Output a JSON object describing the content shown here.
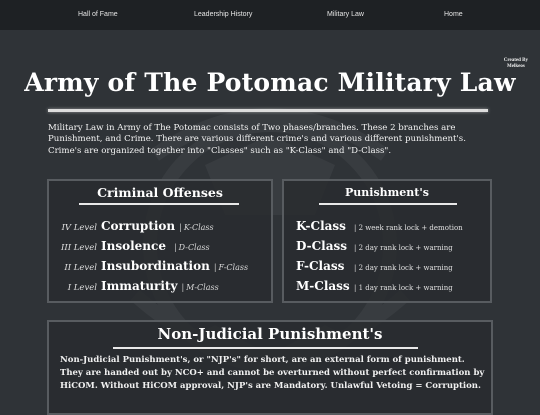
{
  "nav": {
    "items": [
      {
        "label": "Hall of Fame"
      },
      {
        "label": "Leadership History"
      },
      {
        "label": "Military Law"
      },
      {
        "label": "Home"
      }
    ]
  },
  "header": {
    "credit_line1": "Created By",
    "credit_line2": "Melkeos",
    "title": "Army of The Potomac Military Law"
  },
  "intro": {
    "text": "Military Law in Army of The Potomac consists of Two phases/branches. These 2 branches are Punishment, and Crime. There are various different crime's and various different punishment's. Crime's are organized together into \"Classes\" such as \"K-Class\" and \"D-Class\"."
  },
  "offenses": {
    "heading": "Criminal Offenses",
    "rows": [
      {
        "level": "IV Level",
        "name": "Corruption",
        "class": "K-Class"
      },
      {
        "level": "III Level",
        "name": "Insolence",
        "class": "D-Class"
      },
      {
        "level": "II Level",
        "name": "Insubordination",
        "class": "F-Class"
      },
      {
        "level": "I Level",
        "name": "Immaturity",
        "class": "M-Class"
      }
    ]
  },
  "punishments": {
    "heading": "Punishment's",
    "rows": [
      {
        "class": "K-Class",
        "desc": "| 2 week rank lock + demotion"
      },
      {
        "class": "D-Class",
        "desc": "| 2 day rank lock + warning"
      },
      {
        "class": "F-Class",
        "desc": "| 2 day rank lock + warning"
      },
      {
        "class": "M-Class",
        "desc": "| 1 day rank lock + warning"
      }
    ]
  },
  "njp": {
    "heading": "Non-Judicial Punishment's",
    "text": "Non-Judicial Punishment's, or \"NJP's\" for short, are an external form of punishment. They are handed out by NCO+ and cannot be overturned without perfect confirmation by HiCOM. Without HiCOM approval,  NJP's are Mandatory. Unlawful Vetoing = Corruption."
  },
  "colors": {
    "background": "#2f3337",
    "nav_bar": "#1e2124",
    "panel_border": "#585c60",
    "text": "#ffffff"
  }
}
